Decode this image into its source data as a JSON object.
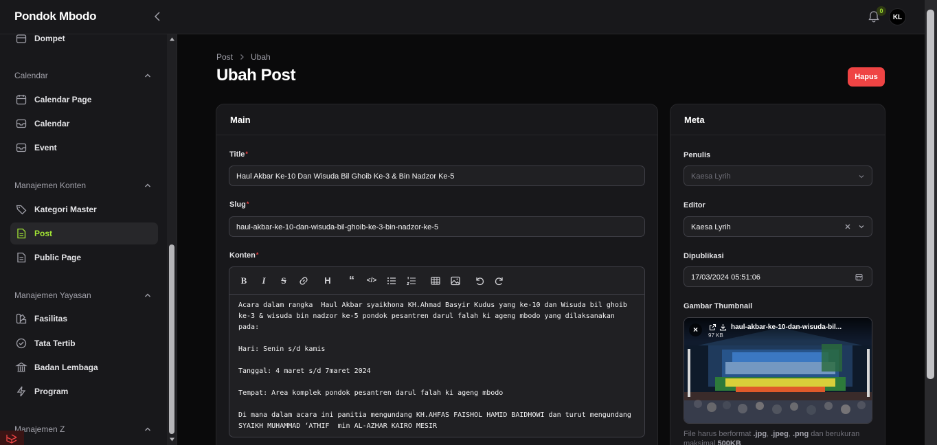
{
  "app": {
    "brand": "Pondok Mbodo"
  },
  "header": {
    "notifications": "0",
    "avatar_initials": "KL"
  },
  "sidebar": {
    "items_top": [
      {
        "label": "Dompet",
        "icon": "wallet-icon"
      }
    ],
    "groups": [
      {
        "label": "Calendar",
        "items": [
          {
            "label": "Calendar Page",
            "icon": "calendar-icon"
          },
          {
            "label": "Calendar",
            "icon": "inbox-icon"
          },
          {
            "label": "Event",
            "icon": "inbox-icon"
          }
        ]
      },
      {
        "label": "Manajemen Konten",
        "items": [
          {
            "label": "Kategori Master",
            "icon": "tag-icon"
          },
          {
            "label": "Post",
            "icon": "document-icon",
            "active": true
          },
          {
            "label": "Public Page",
            "icon": "document-icon"
          }
        ]
      },
      {
        "label": "Manajemen Yayasan",
        "items": [
          {
            "label": "Fasilitas",
            "icon": "swatch-icon"
          },
          {
            "label": "Tata Tertib",
            "icon": "check-circle-icon"
          },
          {
            "label": "Badan Lembaga",
            "icon": "building-icon"
          },
          {
            "label": "Program",
            "icon": "bolt-icon"
          }
        ]
      },
      {
        "label": "Manajemen Z",
        "items": []
      }
    ],
    "accent": "#a3e635"
  },
  "breadcrumb": {
    "items": [
      "Post",
      "Ubah"
    ]
  },
  "page": {
    "title": "Ubah Post",
    "delete_label": "Hapus",
    "delete_color": "#ef4444"
  },
  "main_card": {
    "title": "Main",
    "title_label": "Title",
    "title_value": "Haul Akbar Ke-10 Dan Wisuda Bil Ghoib Ke-3 & Bin Nadzor Ke-5",
    "slug_label": "Slug",
    "slug_value": "haul-akbar-ke-10-dan-wisuda-bil-ghoib-ke-3-bin-nadzor-ke-5",
    "content_label": "Konten",
    "required_mark": "*",
    "toolbar": [
      "bold",
      "italic",
      "strike",
      "link",
      "heading",
      "blockquote",
      "code",
      "bullet-list",
      "ordered-list",
      "table",
      "image",
      "undo",
      "redo"
    ],
    "content": [
      "Acara dalam rangka  Haul Akbar syaikhona KH.Ahmad Basyir Kudus yang ke-10 dan Wisuda bil ghoib ke-3 & wisuda bin nadzor ke-5 pondok pesantren darul falah ki ageng mbodo yang dilaksanakan pada:",
      "Hari: Senin s/d kamis",
      "Tanggal: 4 maret s/d 7maret 2024",
      "Tempat: Area komplek pondok pesantren darul falah ki ageng mbodo",
      "Di mana dalam acara ini panitia mengundang KH.AHFAS FAISHOL HAMID BAIDHOWI dan turut mengundang SYAIKH MUHAMMAD ‘ATHIF  min AL-AZHAR KAIRO MESIR"
    ]
  },
  "meta_card": {
    "title": "Meta",
    "writer_label": "Penulis",
    "writer_value": "Kaesa Lyrih",
    "editor_label": "Editor",
    "editor_value": "Kaesa Lyrih",
    "published_label": "Dipublikasi",
    "published_value": "17/03/2024 05:51:06",
    "thumb_label": "Gambar Thumbnail",
    "thumb_file": "haul-akbar-ke-10-dan-wisuda-bil...",
    "thumb_size": "97 KB",
    "hint_pre": "File harus berformat ",
    "hint_formats": [
      ".jpg",
      ".jpeg",
      ".png"
    ],
    "hint_mid": " dan berukuran maksimal ",
    "hint_size": "500KB"
  }
}
